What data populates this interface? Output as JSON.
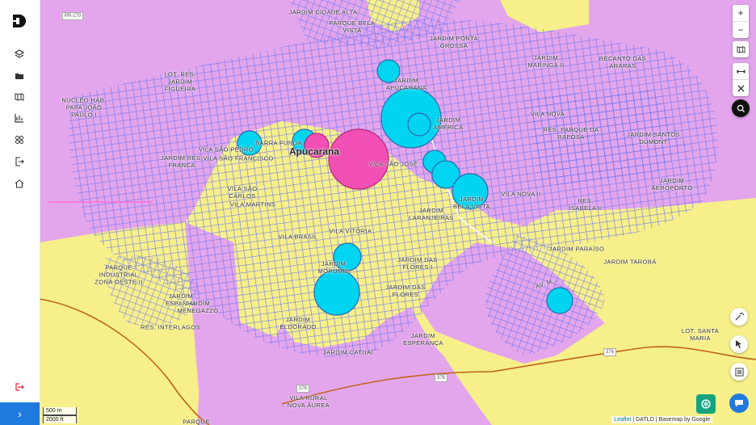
{
  "sidebar": {
    "items": [
      {
        "icon": "layers-icon"
      },
      {
        "icon": "folder-icon"
      },
      {
        "icon": "map-icon"
      },
      {
        "icon": "bar-chart-icon"
      },
      {
        "icon": "grid-icon"
      },
      {
        "icon": "export-icon"
      },
      {
        "icon": "home-icon"
      }
    ],
    "logout_icon": "logout-icon",
    "expand_label": "›"
  },
  "map": {
    "city_label": "Apucarana",
    "neighborhoods": [
      "JARDIM CIDADE ALTA",
      "PARQUE BELA VISTA",
      "JARDIM PONTA GROSSA",
      "JARDIM MARINGÁ II",
      "RECANTO DAS ARARAS",
      "LOT. RES. JARDIM FIGUEIRA",
      "NUCLEO HAB. PAPA JOÃO PAULO I",
      "JARDIM APUCARANA",
      "JARDIM AMÉRICA",
      "VILA NOVA",
      "RES. PARQUE DA RAPOSA",
      "JARDIM SANTOS DUMONT",
      "VILA SÃO PEDRO",
      "BARRA FUNDA",
      "JARDIM RES. FRANCA",
      "VILA SÃO FRANCISCO",
      "VILA SÃO JOSÉ",
      "JARDIM AEROPORTO",
      "VILA SÃO CARLOS",
      "VILA MARTINS",
      "JARDIM BELA VISTA",
      "VILA NOVA II",
      "RES. ISABELA II",
      "JARDIM LARANJEIRAS",
      "VILA BRASIL",
      "VILA VITÓRIA",
      "PARQUE INDUSTRIAL ZONA OESTE II",
      "JARDIM MORUMBI",
      "JARDIM DAS FLORES I",
      "JARDIM PARAÍSO",
      "JARDIM TAROBÁ",
      "JARDIM MENEGAZZO",
      "JARDIM DAS FLORES",
      "JARDIM ESPANHA",
      "RES. INTERLAGOS",
      "JARDIM ELDORADO",
      "LOT. SANTA MARIA",
      "JARDIM ESPERANÇA",
      "JARDIM CATUAÍ",
      "VILA RURAL NOVA ÁUREA",
      "PARQUE"
    ],
    "roads": [
      "PR-170",
      "376",
      "376",
      "376",
      "Av. M..."
    ],
    "circles": [
      {
        "color": "#00d4f0",
        "label": "cluster"
      },
      {
        "color": "#f24fb4",
        "label": "cluster"
      }
    ]
  },
  "controls": {
    "zoom_in": "+",
    "zoom_out": "−",
    "basemap_icon": "map-icon",
    "measure_icon": "ruler-icon",
    "close_icon": "close-icon",
    "search_icon": "search-icon",
    "tool1_icon": "magic-wand-icon",
    "tool2_icon": "cursor-icon",
    "tool3_icon": "list-icon"
  },
  "scale": {
    "metric": "500 m",
    "imperial": "2000 ft"
  },
  "attribution": {
    "leaflet": "Leaflet",
    "rest": " | DATLO | Basemap by Google"
  },
  "colors": {
    "zone_pink": "#e3a6ec",
    "zone_yellow": "#f7f08a",
    "streets": "#6b73f0",
    "cyan_circle": "#00d4f0",
    "magenta_circle": "#f24fb4",
    "accent": "#1f7ae0"
  }
}
